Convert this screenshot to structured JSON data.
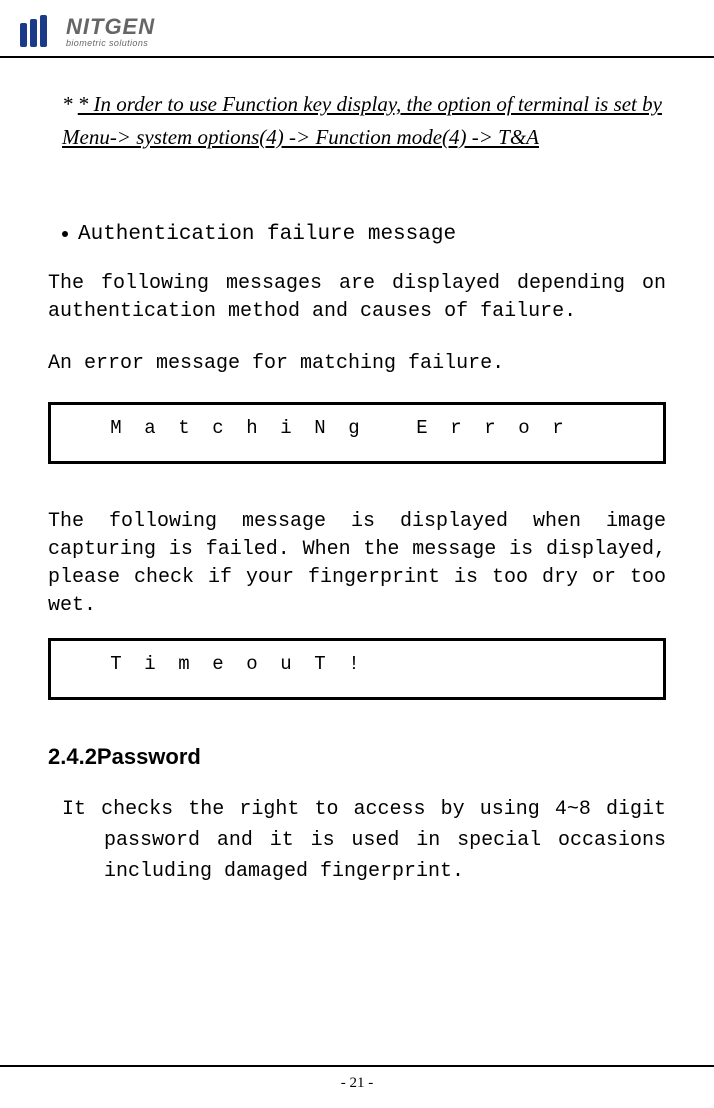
{
  "header": {
    "brand": "NITGEN",
    "tagline": "biometric solutions"
  },
  "note": {
    "prefix": "* ",
    "underlined": "* In order to use Function key display, the option of terminal is set  by Menu-> system options(4) -> Function mode(4) -> T&A"
  },
  "auth_failure_bullet": "Authentication failure message",
  "para1": "The following messages are displayed depending on authentication method and causes of failure.",
  "para2": "An error message for matching failure.",
  "display1_cells": [
    " ",
    "M",
    "a",
    "t",
    "c",
    "h",
    "i",
    "N",
    "g",
    " ",
    "E",
    "r",
    "r",
    "o",
    "r"
  ],
  "para3": "The following message is displayed when image capturing is failed. When the message is displayed, please check if your fingerprint is too dry or too wet.",
  "display2_cells": [
    " ",
    "T",
    "i",
    "m",
    "e",
    "o",
    "u",
    "T",
    "!",
    " ",
    " ",
    " ",
    " ",
    " ",
    " "
  ],
  "section_heading": "2.4.2Password",
  "para4": "It checks the right to access by using 4~8 digit password and it is used in special occasions including damaged fingerprint.",
  "footer": "- 21 -"
}
